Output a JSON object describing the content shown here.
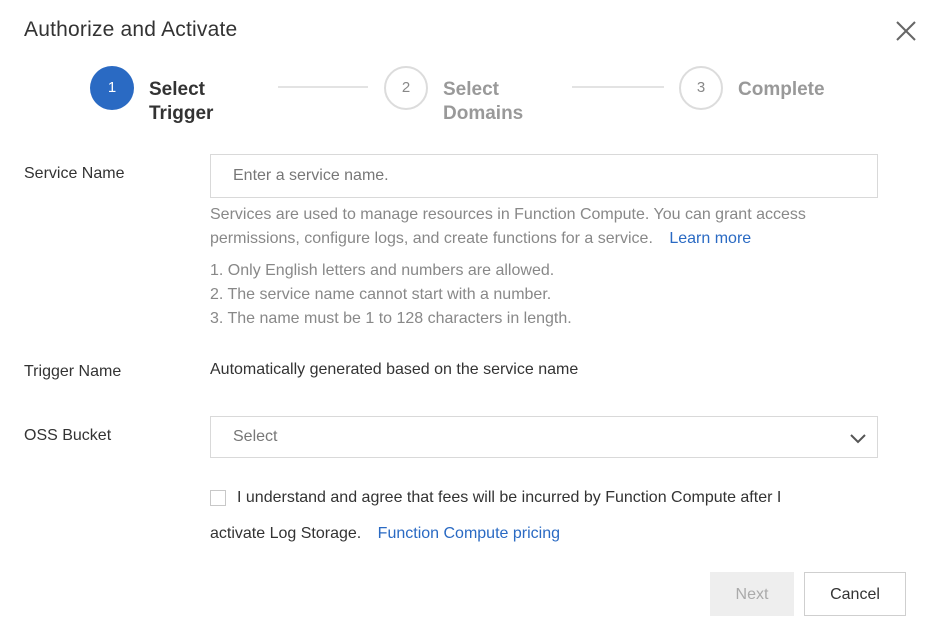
{
  "dialog": {
    "title": "Authorize and Activate",
    "close_icon": "close-icon"
  },
  "steps": [
    {
      "number": "1",
      "line1": "Select",
      "line2": "Trigger",
      "state": "active"
    },
    {
      "number": "2",
      "line1": "Select",
      "line2": "Domains",
      "state": "pending"
    },
    {
      "number": "3",
      "line1": "Complete",
      "line2": "",
      "state": "pending"
    }
  ],
  "service_name": {
    "label": "Service Name",
    "placeholder": "Enter a service name.",
    "value": "",
    "help_line1": "Services are used to manage resources in Function Compute. You can grant access",
    "help_line2": "permissions, configure logs, and create functions for a service.",
    "learn_more": "Learn more",
    "rules": [
      "1. Only English letters and numbers are allowed.",
      "2. The service name cannot start with a number.",
      "3. The name must be 1 to 128 characters in length."
    ]
  },
  "trigger_name": {
    "label": "Trigger Name",
    "value": "Automatically generated based on the service name"
  },
  "oss_bucket": {
    "label": "OSS Bucket",
    "selected": "Select",
    "chevron_icon": "chevron-down-icon"
  },
  "agreement": {
    "checked": false,
    "line1": "I understand and agree that fees will be incurred by Function Compute after I",
    "line2": "activate Log Storage.",
    "pricing_link": "Function Compute pricing"
  },
  "buttons": {
    "next": "Next",
    "cancel": "Cancel"
  },
  "colors": {
    "accent": "#2a6ac3",
    "disabled_bg": "#eeeeee",
    "border": "#d9d9d9"
  }
}
